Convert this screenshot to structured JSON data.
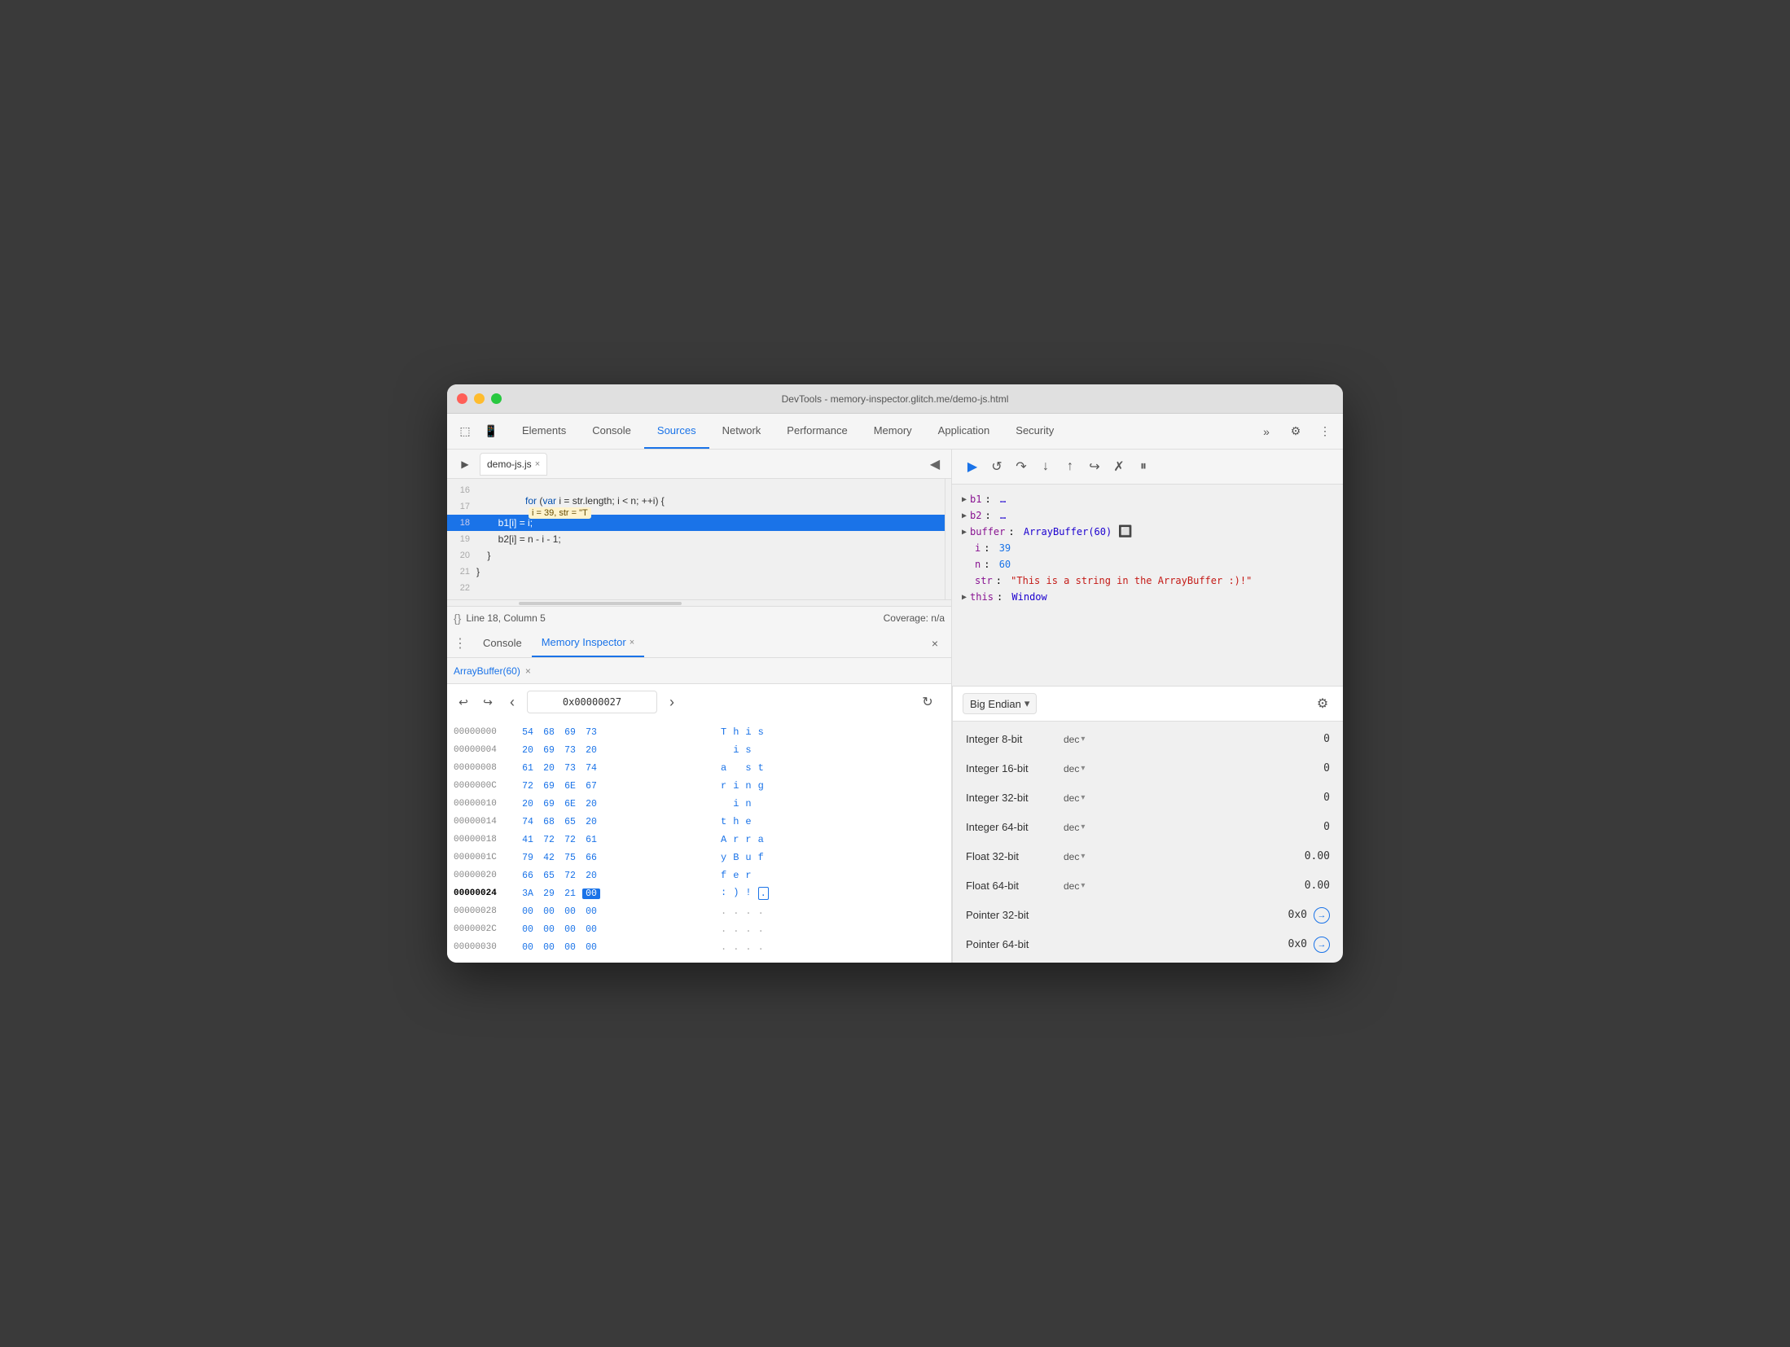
{
  "window": {
    "title": "DevTools - memory-inspector.glitch.me/demo-js.html",
    "traffic_lights": [
      "red",
      "yellow",
      "green"
    ]
  },
  "toolbar": {
    "tabs": [
      {
        "label": "Elements",
        "active": false
      },
      {
        "label": "Console",
        "active": false
      },
      {
        "label": "Sources",
        "active": true
      },
      {
        "label": "Network",
        "active": false
      },
      {
        "label": "Performance",
        "active": false
      },
      {
        "label": "Memory",
        "active": false
      },
      {
        "label": "Application",
        "active": false
      },
      {
        "label": "Security",
        "active": false
      }
    ],
    "more_label": "»",
    "settings_label": "⚙",
    "more_options_label": "⋮"
  },
  "source": {
    "filename": "demo-js.js",
    "close_label": "×",
    "lines": [
      {
        "num": 16,
        "text": "",
        "highlighted": false
      },
      {
        "num": 17,
        "text": "    for (var i = str.length; i < n; ++i) {",
        "highlighted": false,
        "debug_info": "i = 39, str = \"T"
      },
      {
        "num": 18,
        "text": "        b1[i] = i;",
        "highlighted": true
      },
      {
        "num": 19,
        "text": "        b2[i] = n - i - 1;",
        "highlighted": false
      },
      {
        "num": 20,
        "text": "    }",
        "highlighted": false
      },
      {
        "num": 21,
        "text": "}",
        "highlighted": false
      },
      {
        "num": 22,
        "text": "",
        "highlighted": false
      }
    ],
    "status_icon": "{}",
    "status_text": "Line 18, Column 5",
    "coverage_text": "Coverage: n/a"
  },
  "bottom_panel": {
    "tabs": [
      {
        "label": "Console",
        "active": false
      },
      {
        "label": "Memory Inspector",
        "active": true
      }
    ],
    "close_label": "×"
  },
  "memory_inspector": {
    "buffer_tab": "ArrayBuffer(60)",
    "buffer_tab_close": "×",
    "nav": {
      "back_label": "↩",
      "forward_label": "↪",
      "prev_label": "‹",
      "address": "0x00000027",
      "next_label": "›",
      "refresh_label": "↻"
    },
    "rows": [
      {
        "addr": "00000000",
        "bytes": [
          "54",
          "68",
          "69",
          "73"
        ],
        "ascii": [
          "T",
          "h",
          "i",
          "s"
        ],
        "selected": false
      },
      {
        "addr": "00000004",
        "bytes": [
          "20",
          "69",
          "73",
          "20"
        ],
        "ascii": [
          " ",
          "i",
          "s",
          " "
        ],
        "selected": false
      },
      {
        "addr": "00000008",
        "bytes": [
          "61",
          "20",
          "73",
          "74"
        ],
        "ascii": [
          "a",
          " ",
          "s",
          "t"
        ],
        "selected": false
      },
      {
        "addr": "0000000C",
        "bytes": [
          "72",
          "69",
          "6E",
          "67"
        ],
        "ascii": [
          "r",
          "i",
          "n",
          "g"
        ],
        "selected": false
      },
      {
        "addr": "00000010",
        "bytes": [
          "20",
          "69",
          "6E",
          "20"
        ],
        "ascii": [
          " ",
          "i",
          "n",
          " "
        ],
        "selected": false
      },
      {
        "addr": "00000014",
        "bytes": [
          "74",
          "68",
          "65",
          "20"
        ],
        "ascii": [
          "t",
          "h",
          "e",
          " "
        ],
        "selected": false
      },
      {
        "addr": "00000018",
        "bytes": [
          "41",
          "72",
          "72",
          "61"
        ],
        "ascii": [
          "A",
          "r",
          "r",
          "a"
        ],
        "selected": false
      },
      {
        "addr": "0000001C",
        "bytes": [
          "79",
          "42",
          "75",
          "66"
        ],
        "ascii": [
          "y",
          "B",
          "u",
          "f"
        ],
        "selected": false
      },
      {
        "addr": "00000020",
        "bytes": [
          "66",
          "65",
          "72",
          "20"
        ],
        "ascii": [
          "f",
          "e",
          "r",
          " "
        ],
        "selected": false
      },
      {
        "addr": "00000024",
        "bytes": [
          "3A",
          "29",
          "21",
          "00"
        ],
        "ascii": [
          ":",
          ")",
          " !",
          "."
        ],
        "selected": true,
        "selected_byte_idx": 3
      },
      {
        "addr": "00000028",
        "bytes": [
          "00",
          "00",
          "00",
          "00"
        ],
        "ascii": [
          ".",
          ".",
          ".",
          "."
        ],
        "selected": false
      },
      {
        "addr": "0000002C",
        "bytes": [
          "00",
          "00",
          "00",
          "00"
        ],
        "ascii": [
          ".",
          ".",
          ".",
          "."
        ],
        "selected": false
      },
      {
        "addr": "00000030",
        "bytes": [
          "00",
          "00",
          "00",
          "00"
        ],
        "ascii": [
          ".",
          ".",
          ".",
          "."
        ],
        "selected": false
      }
    ]
  },
  "debugger": {
    "buttons": [
      "▶",
      "⟳",
      "⬇",
      "⬆",
      "⤵",
      "✗",
      "⏸"
    ]
  },
  "scope": {
    "items": [
      {
        "arrow": "▶",
        "key": "b1",
        "val": "…"
      },
      {
        "arrow": "▶",
        "key": "b2",
        "val": "…"
      },
      {
        "arrow": "▶",
        "key": "buffer",
        "val": "ArrayBuffer(60)",
        "has_icon": true
      },
      {
        "key": "i",
        "val": "39"
      },
      {
        "key": "n",
        "val": "60"
      },
      {
        "key": "str",
        "val": "\"This is a string in the ArrayBuffer :)!\""
      },
      {
        "arrow": "▶",
        "key": "this",
        "val": "Window"
      }
    ]
  },
  "value_inspector": {
    "endian": "Big Endian",
    "endian_caret": "▾",
    "gear_label": "⚙",
    "rows": [
      {
        "label": "Integer 8-bit",
        "type": "dec",
        "value": "0"
      },
      {
        "label": "Integer 16-bit",
        "type": "dec",
        "value": "0"
      },
      {
        "label": "Integer 32-bit",
        "type": "dec",
        "value": "0"
      },
      {
        "label": "Integer 64-bit",
        "type": "dec",
        "value": "0"
      },
      {
        "label": "Float 32-bit",
        "type": "dec",
        "value": "0.00"
      },
      {
        "label": "Float 64-bit",
        "type": "dec",
        "value": "0.00"
      },
      {
        "label": "Pointer 32-bit",
        "type": "",
        "value": "0x0",
        "has_link": true
      },
      {
        "label": "Pointer 64-bit",
        "type": "",
        "value": "0x0",
        "has_link": true
      }
    ]
  }
}
